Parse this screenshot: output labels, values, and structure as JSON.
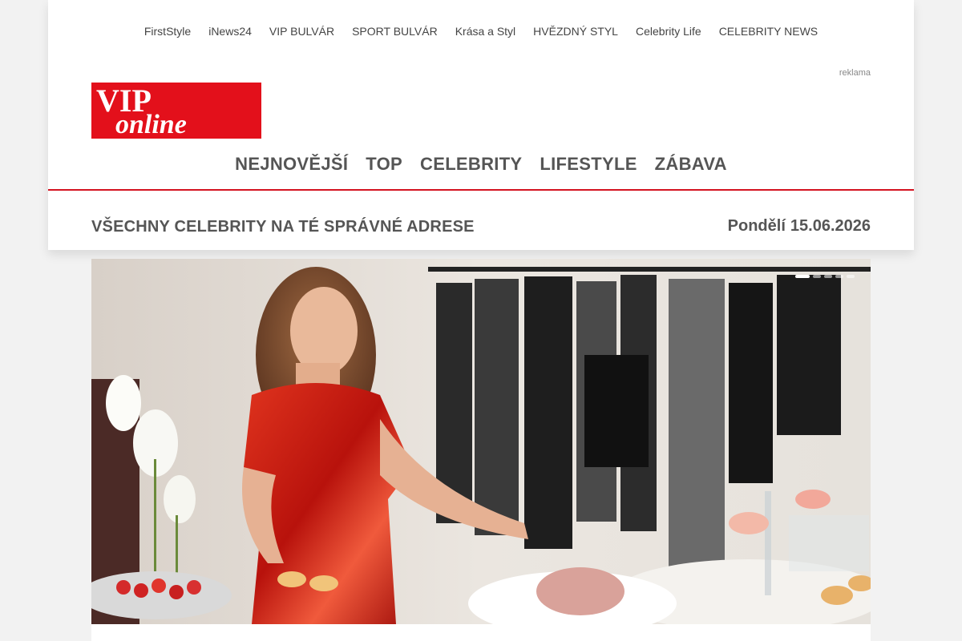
{
  "top_links": [
    "FirstStyle",
    "iNews24",
    "VIP BULVÁR",
    "SPORT BULVÁR",
    "Krása a Styl",
    "HVĚZDNÝ STYL",
    "Celebrity Life",
    "CELEBRITY NEWS"
  ],
  "ad_label": "reklama",
  "logo": {
    "line1": "VIP",
    "line2": "online"
  },
  "main_nav": [
    "NEJNOVĚJŠÍ",
    "TOP",
    "CELEBRITY",
    "LIFESTYLE",
    "ZÁBAVA"
  ],
  "tagline": "VŠECHNY CELEBRITY NA TÉ SPRÁVNÉ ADRESE",
  "date": {
    "weekday": "Pondělí",
    "value": "15.06.2026"
  },
  "slider": {
    "slide_count": 5,
    "active_index": 0
  },
  "colors": {
    "brand_red": "#e3101b",
    "accent_line": "#d41220",
    "text_gray": "#555555"
  }
}
